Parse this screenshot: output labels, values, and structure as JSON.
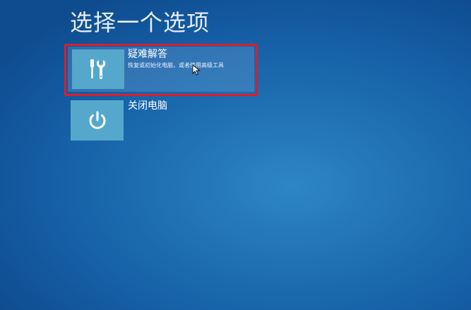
{
  "screen": {
    "title": "选择一个选项"
  },
  "options": [
    {
      "title": "疑难解答",
      "description": "恢复或初始化电脑，或者使用高级工具",
      "icon": "tools-icon"
    },
    {
      "title": "关闭电脑",
      "icon": "power-icon"
    }
  ],
  "colors": {
    "background": "#1c6cb0",
    "tile": "#55a8cc",
    "highlight": "#d8202c"
  }
}
